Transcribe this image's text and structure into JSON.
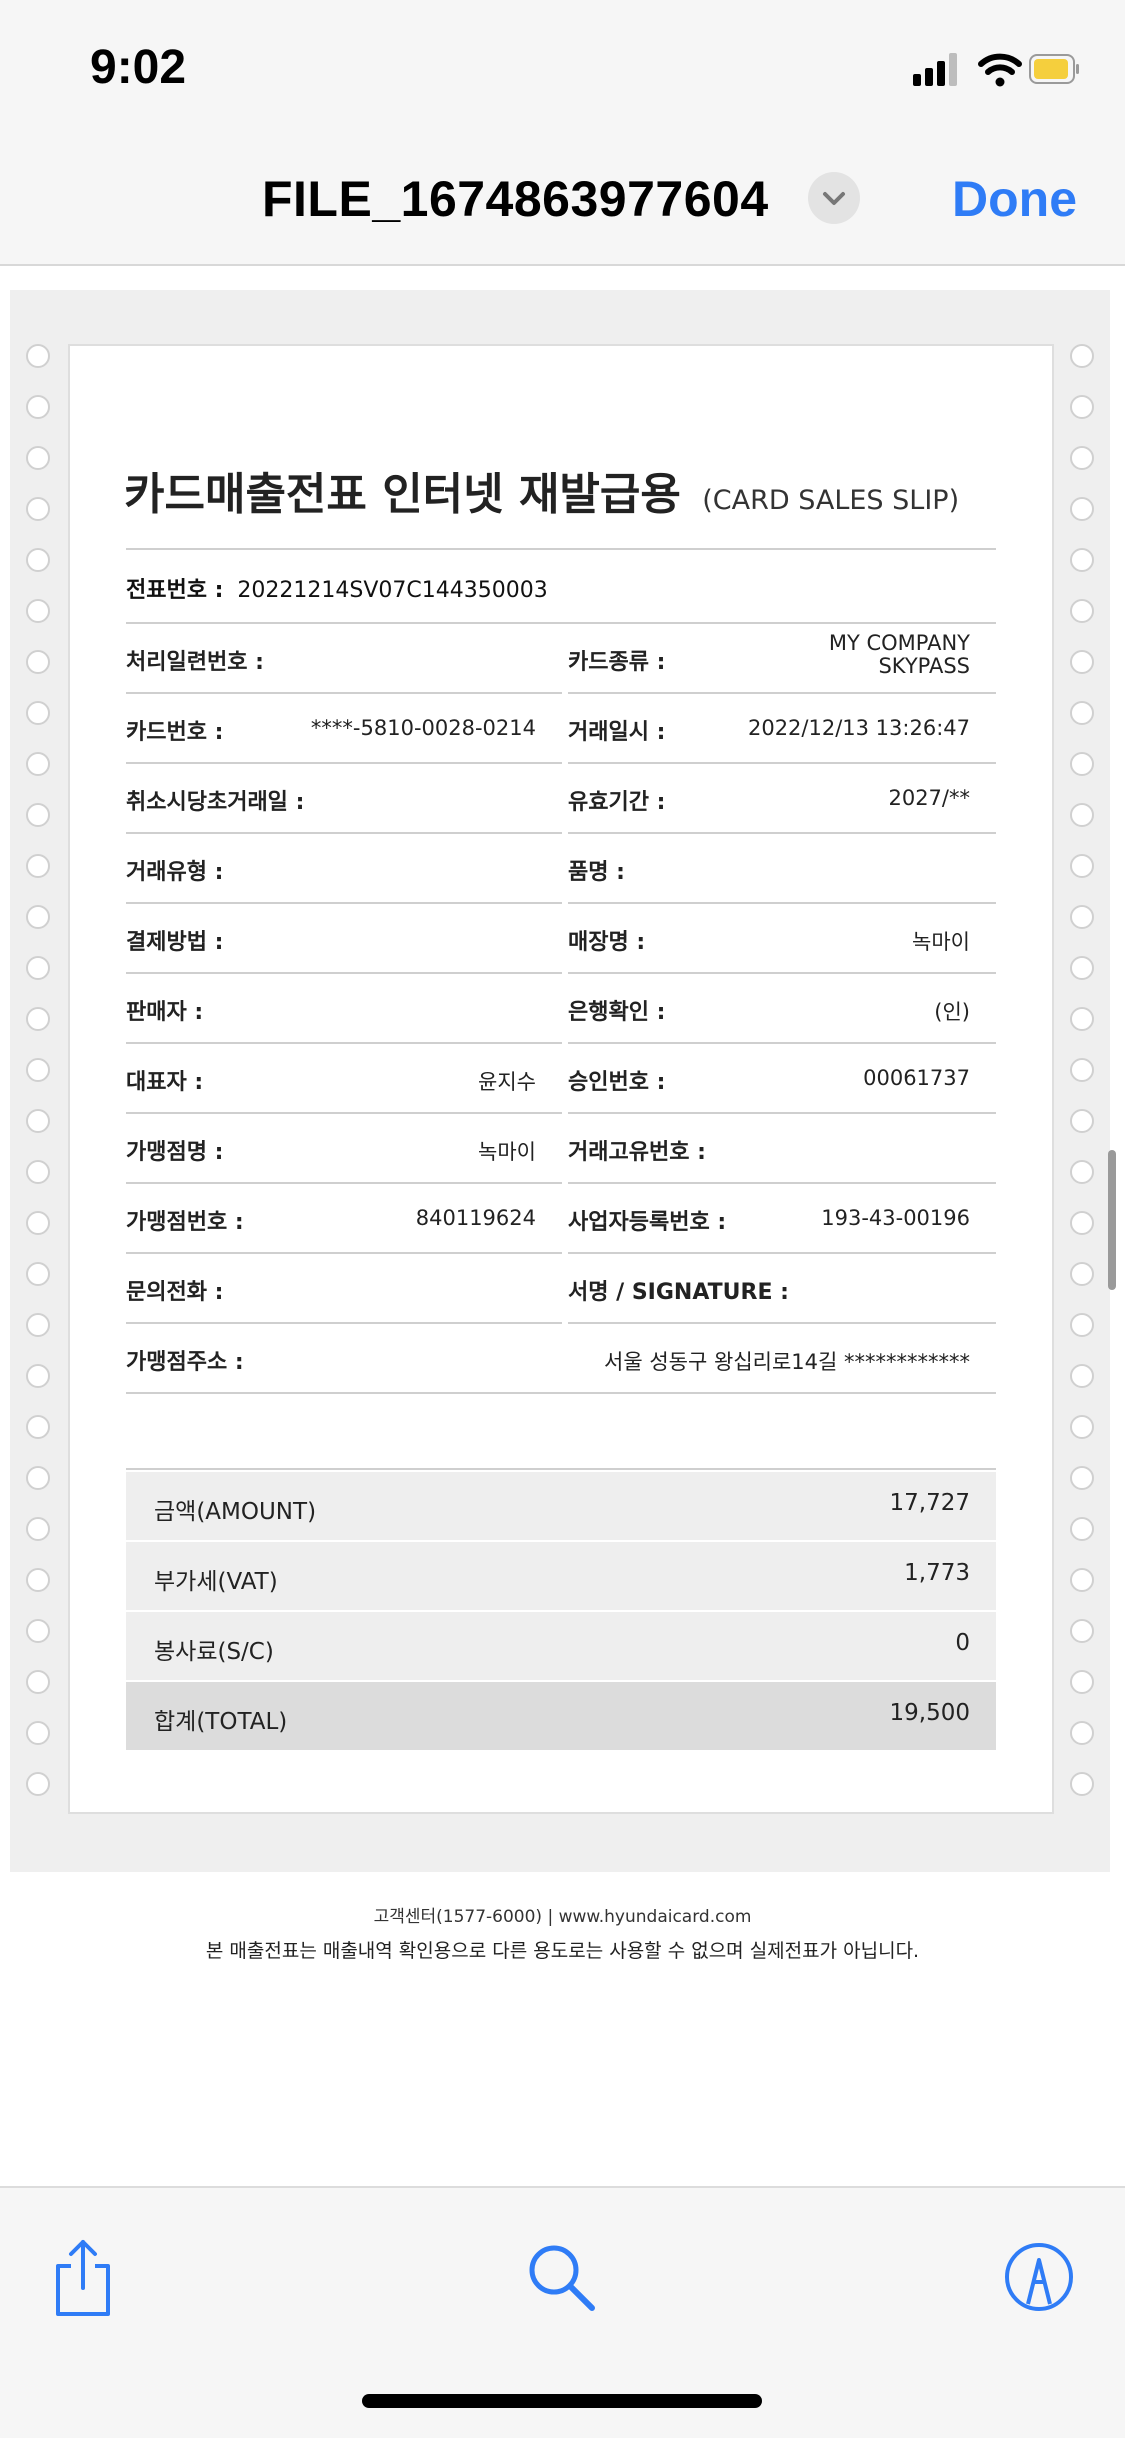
{
  "status_bar": {
    "time": "9:02",
    "battery_color": "#f5cf3d"
  },
  "nav": {
    "title": "FILE_1674863977604",
    "done_label": "Done",
    "accent": "#2f7cf6"
  },
  "slip": {
    "title": "카드매출전표 인터넷 재발급용",
    "title_en": "(CARD SALES SLIP)",
    "slip_no_label": "전표번호 :",
    "slip_no": "20221214SV07C144350003",
    "left": [
      {
        "label": "처리일련번호 :",
        "value": ""
      },
      {
        "label": "카드번호 :",
        "value": "****-5810-0028-0214"
      },
      {
        "label": "취소시당초거래일 :",
        "value": ""
      },
      {
        "label": "거래유형 :",
        "value": ""
      },
      {
        "label": "결제방법 :",
        "value": ""
      },
      {
        "label": "판매자 :",
        "value": ""
      },
      {
        "label": "대표자 :",
        "value": "윤지수"
      },
      {
        "label": "가맹점명 :",
        "value": "녹마이"
      },
      {
        "label": "가맹점번호 :",
        "value": "840119624"
      },
      {
        "label": "문의전화 :",
        "value": ""
      }
    ],
    "right": [
      {
        "label": "카드종류 :",
        "value": "MY COMPANY",
        "value2": "SKYPASS"
      },
      {
        "label": "거래일시 :",
        "value": "2022/12/13 13:26:47",
        "value2": ""
      },
      {
        "label": "유효기간 :",
        "value": "2027/**",
        "value2": ""
      },
      {
        "label": "품명 :",
        "value": "",
        "value2": ""
      },
      {
        "label": "매장명 :",
        "value": "녹마이",
        "value2": ""
      },
      {
        "label": "은행확인 :",
        "value": "(인)",
        "value2": ""
      },
      {
        "label": "승인번호 :",
        "value": "00061737",
        "value2": ""
      },
      {
        "label": "거래고유번호 :",
        "value": "",
        "value2": ""
      },
      {
        "label": "사업자등록번호 :",
        "value": "193-43-00196",
        "value2": ""
      },
      {
        "label": "서명 / SIGNATURE :",
        "value": "",
        "value2": ""
      }
    ],
    "address_label": "가맹점주소 :",
    "address_value": "서울 성동구 왕십리로14길 ************",
    "totals": [
      {
        "label": "금액(AMOUNT)",
        "value": "17,727"
      },
      {
        "label": "부가세(VAT)",
        "value": "1,773"
      },
      {
        "label": "봉사료(S/C)",
        "value": "0"
      },
      {
        "label": "합계(TOTAL)",
        "value": "19,500"
      }
    ]
  },
  "footer": {
    "contact": "고객센터(1577-6000)  |  www.hyundaicard.com",
    "notice": "본 매출전표는 매출내역 확인용으로 다른 용도로는 사용할 수 없으며 실제전표가 아닙니다."
  },
  "toolbar": {
    "icons": [
      "share-icon",
      "search-icon",
      "markup-icon"
    ]
  }
}
